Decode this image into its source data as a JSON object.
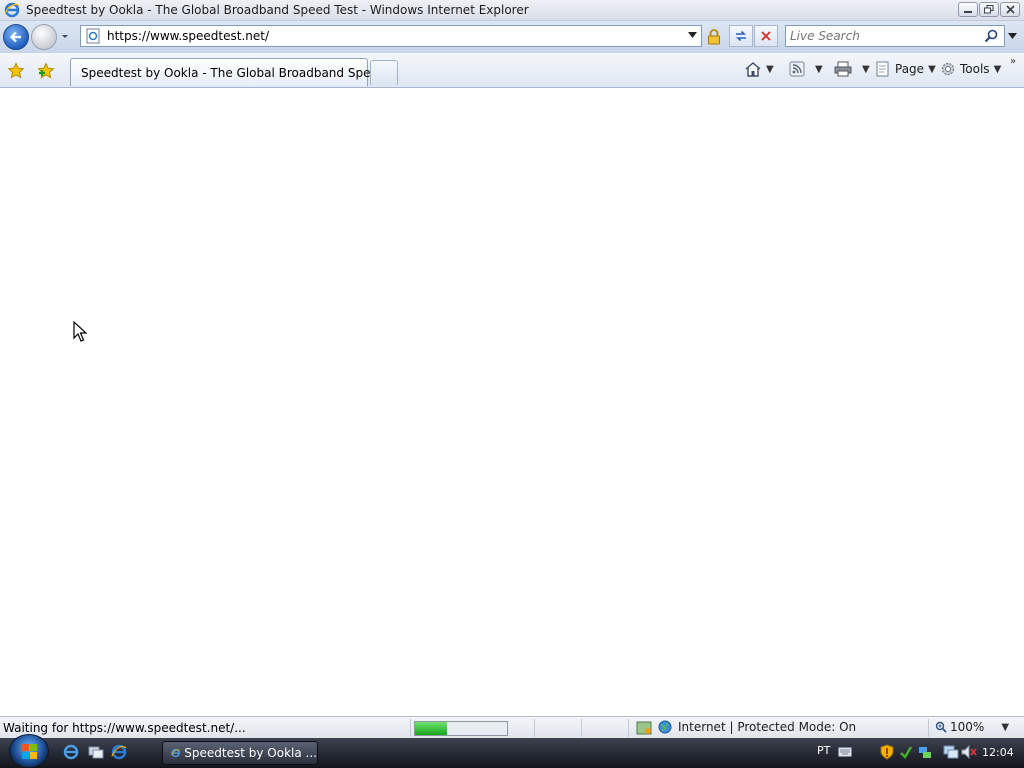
{
  "window": {
    "title": "Speedtest by Ookla - The Global Broadband Speed Test - Windows Internet Explorer"
  },
  "address_bar": {
    "url": "https://www.speedtest.net/"
  },
  "search": {
    "placeholder": "Live Search"
  },
  "tabs": [
    {
      "label": "Speedtest by Ookla - The Global Broadband Spee..."
    }
  ],
  "command_bar": {
    "page_label": "Page",
    "tools_label": "Tools"
  },
  "status_bar": {
    "status_text": "Waiting for https://www.speedtest.net/...",
    "progress": 0.35,
    "zone_text": "Internet | Protected Mode: On",
    "zoom": "100%"
  },
  "taskbar": {
    "task_label": "Speedtest by Ookla ...",
    "language": "PT",
    "clock": "12:04"
  },
  "colors": {
    "accent": "#1f5fbf",
    "progress": "#1aa51a"
  }
}
